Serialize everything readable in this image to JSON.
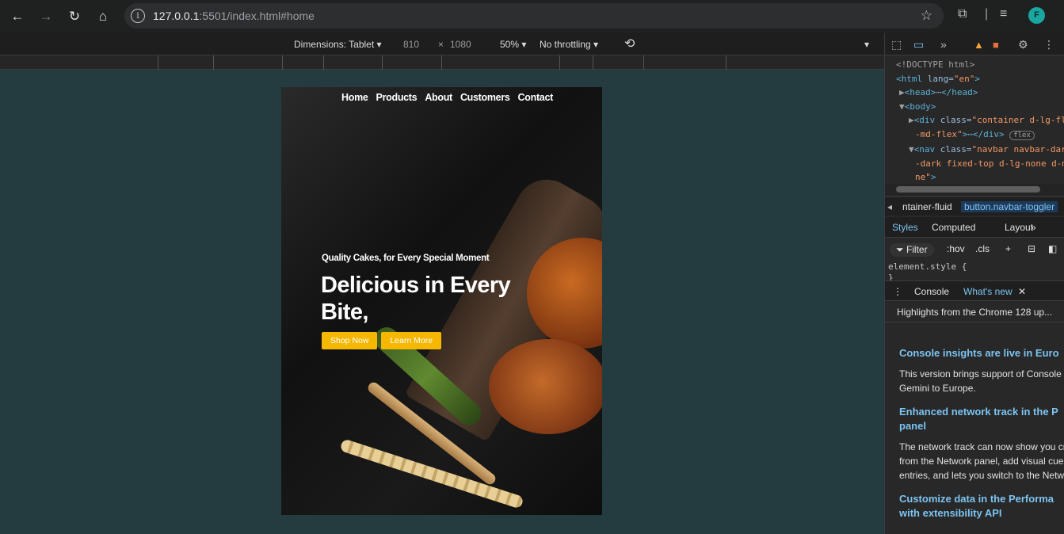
{
  "browser": {
    "url_host": "127.0.0.1",
    "url_rest": ":5501/index.html#home",
    "profile_initial": "F"
  },
  "device_toolbar": {
    "dimensions_label": "Dimensions: Tablet",
    "width": "810",
    "times": "×",
    "height": "1080",
    "zoom": "50%",
    "throttling": "No throttling"
  },
  "site": {
    "nav": [
      "Home",
      "Products",
      "About",
      "Customers",
      "Contact"
    ],
    "hero_subtitle": "Quality Cakes, for Every Special Moment",
    "hero_title": "Delicious in Every Bite,",
    "buttons": [
      "Shop Now",
      "Learn More"
    ]
  },
  "devtools": {
    "elements": {
      "doctype": "<!DOCTYPE html>",
      "html_open": "<html ",
      "html_attr": "lang=",
      "html_val": "\"en\"",
      "html_close": ">",
      "head": "<head>",
      "head_ellipsis": "⋯",
      "head_close": "</head>",
      "body": "<body>",
      "div_open": "<div ",
      "div_attr": "class=",
      "div_val": "\"container d-lg-fl",
      "div_val2": "-md-flex\"",
      "div_close": ">⋯</div>",
      "flex_badge": "flex",
      "nav_open": "<nav ",
      "nav_attr": "class=",
      "nav_val": "\"navbar navbar-dar",
      "nav_val2": "-dark fixed-top d-lg-none d-m",
      "nav_val3": "ne\"",
      "nav_close": ">"
    },
    "breadcrumb": [
      "ntainer-fluid",
      "button.navbar-toggler"
    ],
    "subtabs": [
      "Styles",
      "Computed",
      "Layout"
    ],
    "filter": [
      "Filter",
      ":hov",
      ".cls"
    ],
    "element_style": "element.style {",
    "element_style_close": "}",
    "drawer_tabs": [
      "Console",
      "What's new"
    ],
    "highlights": "Highlights from the Chrome 128 up...",
    "whats_new": [
      {
        "heading": "Console insights are live in Euro",
        "heading2": "",
        "body": [
          "This version brings support of Console i",
          "Gemini to Europe."
        ]
      },
      {
        "heading": "Enhanced network track in the P",
        "heading2": "panel",
        "body": [
          "The network track can now show you cr",
          "from the Network panel, add visual cues",
          "entries, and lets you switch to the Netw"
        ]
      },
      {
        "heading": "Customize data in the Performa",
        "heading2": "with extensibility API",
        "body": []
      }
    ]
  }
}
